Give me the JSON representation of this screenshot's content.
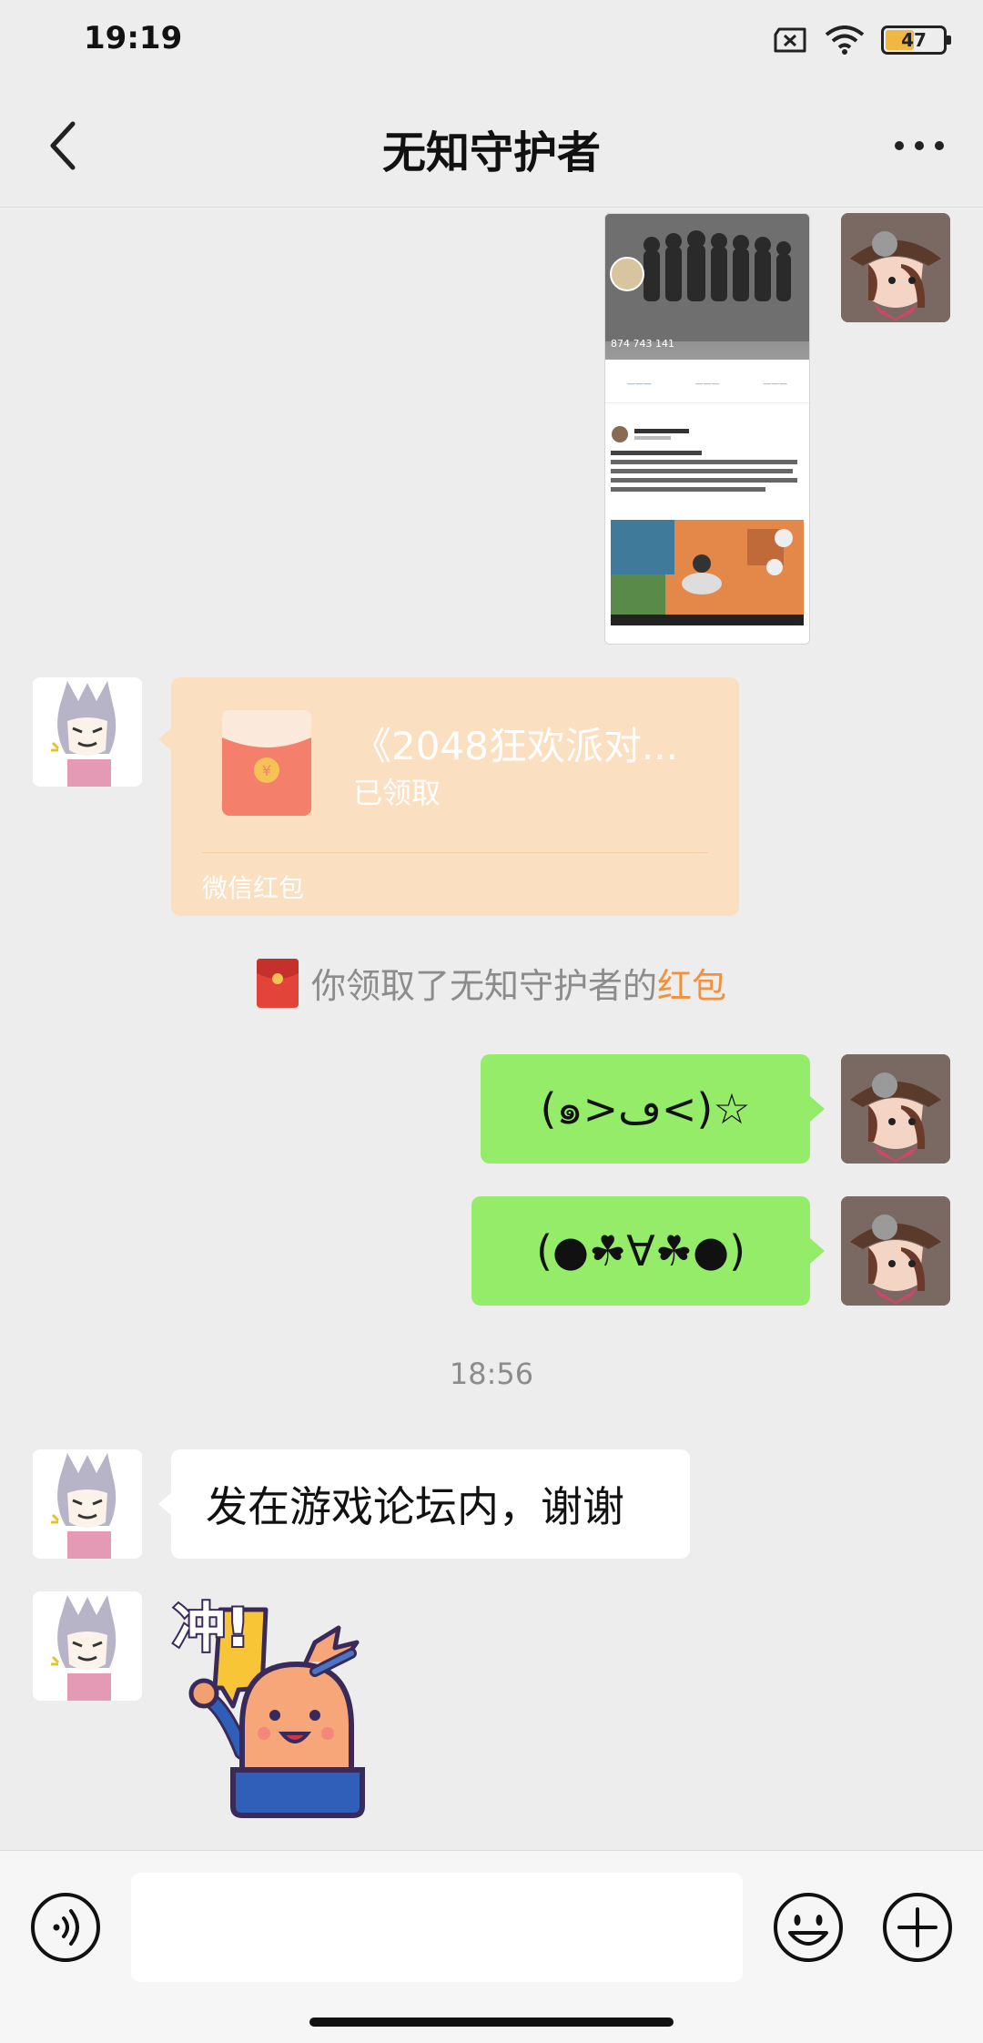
{
  "status_bar": {
    "time": "19:19",
    "battery": "47",
    "battery_level": 0.47
  },
  "nav": {
    "title": "无知守护者",
    "back_icon": "chevron-left-icon",
    "more_icon": "more-dots-icon"
  },
  "screenshot_message": {
    "stats": "874   743   141"
  },
  "red_packet": {
    "title": "《2048狂欢派对...",
    "status": "已领取",
    "footer": "微信红包"
  },
  "system_notice": {
    "text": "你领取了无知守护者的",
    "highlight": "红包"
  },
  "messages": {
    "m1": "(๑>ڡ<)☆",
    "m2": "(●☘∀☘●)",
    "timestamp": "18:56",
    "m3": "发在游戏论坛内，谢谢"
  },
  "sticker": {
    "text": "冲!"
  },
  "input_bar": {
    "placeholder": "",
    "voice_icon": "voice-icon",
    "emoji_icon": "emoji-icon",
    "plus_icon": "plus-icon"
  },
  "colors": {
    "bubble_green": "#95ec69",
    "red_packet_bg": "#fbdfc1",
    "highlight": "#f2913c"
  }
}
